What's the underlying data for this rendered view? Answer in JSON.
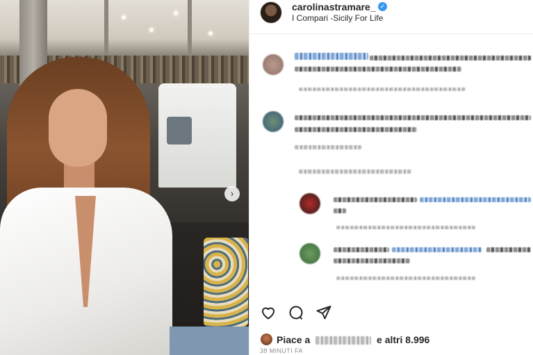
{
  "post": {
    "username": "carolinastramare_",
    "verified": true,
    "location": "I Compari -Sicily For Life"
  },
  "actions": {
    "icons": [
      "heart-icon",
      "comment-icon",
      "share-icon"
    ]
  },
  "likes": {
    "prefix": "Piace a",
    "suffix": "e altri 8.996"
  },
  "timestamp": "38 MINUTI FA",
  "colors": {
    "verified_badge": "#3897f0",
    "text": "#262626",
    "muted": "#8e8e8e"
  }
}
